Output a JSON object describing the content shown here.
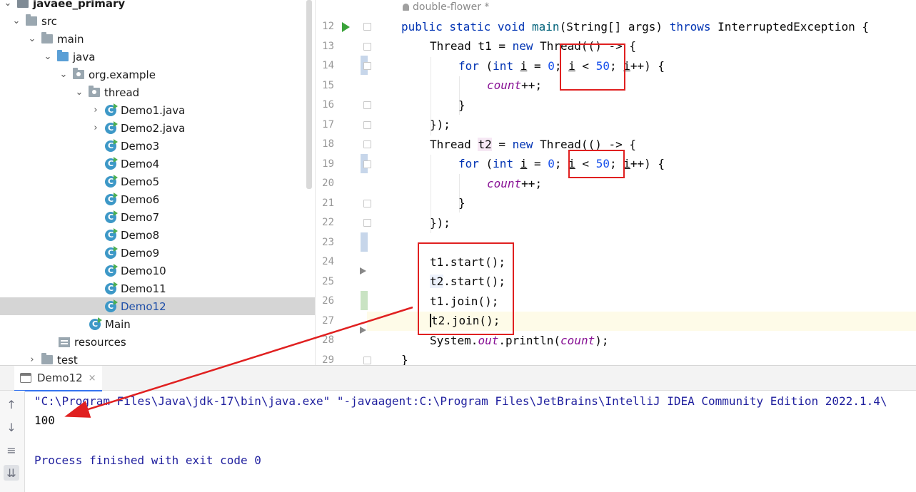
{
  "project": {
    "root": "javaee_primary",
    "items": [
      {
        "label": "src",
        "kind": "folder",
        "expanded": true
      },
      {
        "label": "main",
        "kind": "folder",
        "expanded": true
      },
      {
        "label": "java",
        "kind": "source",
        "expanded": true
      },
      {
        "label": "org.example",
        "kind": "package",
        "expanded": true
      },
      {
        "label": "thread",
        "kind": "package",
        "expanded": true
      },
      {
        "label": "Demo1.java",
        "kind": "class",
        "expanded": false
      },
      {
        "label": "Demo2.java",
        "kind": "class",
        "expanded": false
      },
      {
        "label": "Demo3",
        "kind": "class"
      },
      {
        "label": "Demo4",
        "kind": "class"
      },
      {
        "label": "Demo5",
        "kind": "class"
      },
      {
        "label": "Demo6",
        "kind": "class"
      },
      {
        "label": "Demo7",
        "kind": "class"
      },
      {
        "label": "Demo8",
        "kind": "class"
      },
      {
        "label": "Demo9",
        "kind": "class"
      },
      {
        "label": "Demo10",
        "kind": "class"
      },
      {
        "label": "Demo11",
        "kind": "class"
      },
      {
        "label": "Demo12",
        "kind": "class",
        "selected": true
      },
      {
        "label": "Main",
        "kind": "class"
      },
      {
        "label": "resources",
        "kind": "resources"
      },
      {
        "label": "test",
        "kind": "folder",
        "expanded": false
      }
    ]
  },
  "editor": {
    "author": "double-flower *",
    "line_numbers": [
      "12",
      "13",
      "14",
      "15",
      "16",
      "17",
      "18",
      "19",
      "20",
      "21",
      "22",
      "23",
      "24",
      "25",
      "26",
      "27",
      "28",
      "29"
    ],
    "code": {
      "l12": {
        "a": "public static void ",
        "b": "main",
        "c": "(String[] args) ",
        "d": "throws ",
        "e": "InterruptedException {"
      },
      "l13": {
        "a": "Thread t1 = ",
        "b": "new ",
        "c": "Thread(() -> {"
      },
      "l14": {
        "a": "for ",
        "b": "(",
        "c": "int ",
        "d": "i",
        " e": "",
        "f": " = ",
        "g": "0",
        "h": "; ",
        "i": "i",
        "j": " < ",
        "k": "50",
        "l": "; ",
        "m": "i",
        "n": "++) {"
      },
      "l15": {
        "a": "count",
        "b": "++;"
      },
      "l16": "}",
      "l17": "});",
      "l18": {
        "a": "Thread ",
        "b": "t2",
        "c": " = ",
        "d": "new ",
        "e": "Thread(() -> {"
      },
      "l19": {
        "a": "for ",
        "b": "(",
        "c": "int ",
        "d": "i",
        "f": " = ",
        "g": "0",
        "h": "; ",
        "i": "i",
        "j": " < ",
        "k": "50",
        "l": "; ",
        "m": "i",
        "n": "++) {"
      },
      "l20": {
        "a": "count",
        "b": "++;"
      },
      "l21": "}",
      "l22": "});",
      "l24": "t1.start();",
      "l25": {
        "a": "t2",
        ".b": "",
        "b": ".start();"
      },
      "l26": "t1.join();",
      "l27": {
        "a": "t2",
        "b": ".join();"
      },
      "l28": {
        "a": "System.",
        "b": "out",
        "c": ".println(",
        "d": "count",
        "e": ");"
      },
      "l29": "}"
    }
  },
  "run": {
    "tab_label": "Demo12",
    "close_glyph": "×",
    "console_lines": [
      "\"C:\\Program Files\\Java\\jdk-17\\bin\\java.exe\" \"-javaagent:C:\\Program Files\\JetBrains\\IntelliJ IDEA Community Edition 2022.1.4\\",
      "100",
      "",
      "Process finished with exit code 0"
    ]
  },
  "colors": {
    "keyword": "#0033b3",
    "number": "#1750eb",
    "field": "#871094",
    "annotation_red": "#e02020",
    "run_green": "#3aa33a"
  },
  "icons": {
    "run": "play-icon",
    "up": "arrow-up-icon",
    "down": "arrow-down-icon",
    "wrap": "soft-wrap-icon",
    "scroll": "scroll-to-end-icon"
  }
}
